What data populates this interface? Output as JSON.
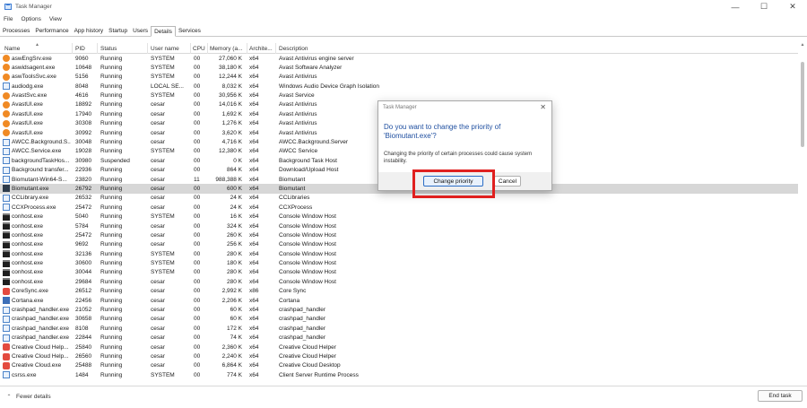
{
  "window": {
    "title": "Task Manager",
    "controls": [
      "—",
      "☐",
      "✕"
    ]
  },
  "menu": [
    "File",
    "Options",
    "View"
  ],
  "tabs": [
    {
      "label": "Processes",
      "active": false
    },
    {
      "label": "Performance",
      "active": false
    },
    {
      "label": "App history",
      "active": false
    },
    {
      "label": "Startup",
      "active": false
    },
    {
      "label": "Users",
      "active": false
    },
    {
      "label": "Details",
      "active": true
    },
    {
      "label": "Services",
      "active": false
    }
  ],
  "columns": {
    "name": "Name",
    "pid": "PID",
    "status": "Status",
    "user": "User name",
    "cpu": "CPU",
    "memory": "Memory (a...",
    "arch": "Archite...",
    "desc": "Description"
  },
  "rows": [
    {
      "icon": "avast",
      "name": "aswEngSrv.exe",
      "pid": "9060",
      "status": "Running",
      "user": "SYSTEM",
      "cpu": "00",
      "mem": "27,060 K",
      "arch": "x64",
      "desc": "Avast Antivirus engine server"
    },
    {
      "icon": "avast",
      "name": "aswidsagent.exe",
      "pid": "10648",
      "status": "Running",
      "user": "SYSTEM",
      "cpu": "00",
      "mem": "38,180 K",
      "arch": "x64",
      "desc": "Avast Software Analyzer"
    },
    {
      "icon": "avast",
      "name": "aswToolsSvc.exe",
      "pid": "5156",
      "status": "Running",
      "user": "SYSTEM",
      "cpu": "00",
      "mem": "12,244 K",
      "arch": "x64",
      "desc": "Avast Antivirus"
    },
    {
      "icon": "app",
      "name": "audiodg.exe",
      "pid": "8048",
      "status": "Running",
      "user": "LOCAL SE...",
      "cpu": "00",
      "mem": "8,032 K",
      "arch": "x64",
      "desc": "Windows Audio Device Graph Isolation"
    },
    {
      "icon": "avast",
      "name": "AvastSvc.exe",
      "pid": "4616",
      "status": "Running",
      "user": "SYSTEM",
      "cpu": "00",
      "mem": "30,956 K",
      "arch": "x64",
      "desc": "Avast Service"
    },
    {
      "icon": "avast",
      "name": "AvastUI.exe",
      "pid": "18892",
      "status": "Running",
      "user": "cesar",
      "cpu": "00",
      "mem": "14,016 K",
      "arch": "x64",
      "desc": "Avast Antivirus"
    },
    {
      "icon": "avast",
      "name": "AvastUI.exe",
      "pid": "17940",
      "status": "Running",
      "user": "cesar",
      "cpu": "00",
      "mem": "1,692 K",
      "arch": "x64",
      "desc": "Avast Antivirus"
    },
    {
      "icon": "avast",
      "name": "AvastUI.exe",
      "pid": "30308",
      "status": "Running",
      "user": "cesar",
      "cpu": "00",
      "mem": "1,276 K",
      "arch": "x64",
      "desc": "Avast Antivirus"
    },
    {
      "icon": "avast",
      "name": "AvastUI.exe",
      "pid": "30992",
      "status": "Running",
      "user": "cesar",
      "cpu": "00",
      "mem": "3,620 K",
      "arch": "x64",
      "desc": "Avast Antivirus"
    },
    {
      "icon": "app",
      "name": "AWCC.Background.S...",
      "pid": "30048",
      "status": "Running",
      "user": "cesar",
      "cpu": "00",
      "mem": "4,716 K",
      "arch": "x64",
      "desc": "AWCC.Background.Server"
    },
    {
      "icon": "app",
      "name": "AWCC.Service.exe",
      "pid": "19028",
      "status": "Running",
      "user": "SYSTEM",
      "cpu": "00",
      "mem": "12,380 K",
      "arch": "x64",
      "desc": "AWCC Service"
    },
    {
      "icon": "app",
      "name": "backgroundTaskHos...",
      "pid": "30980",
      "status": "Suspended",
      "user": "cesar",
      "cpu": "00",
      "mem": "0 K",
      "arch": "x64",
      "desc": "Background Task Host"
    },
    {
      "icon": "app",
      "name": "Background transfer...",
      "pid": "22936",
      "status": "Running",
      "user": "cesar",
      "cpu": "00",
      "mem": "864 K",
      "arch": "x64",
      "desc": "Download/Upload Host"
    },
    {
      "icon": "app",
      "name": "Biomutant-Win64-S...",
      "pid": "23820",
      "status": "Running",
      "user": "cesar",
      "cpu": "11",
      "mem": "988,388 K",
      "arch": "x64",
      "desc": "Biomutant"
    },
    {
      "icon": "game",
      "name": "Biomutant.exe",
      "pid": "26792",
      "status": "Running",
      "user": "cesar",
      "cpu": "00",
      "mem": "600 K",
      "arch": "x64",
      "desc": "Biomutant",
      "selected": true
    },
    {
      "icon": "app",
      "name": "CCLibrary.exe",
      "pid": "26532",
      "status": "Running",
      "user": "cesar",
      "cpu": "00",
      "mem": "24 K",
      "arch": "x64",
      "desc": "CCLibraries"
    },
    {
      "icon": "app",
      "name": "CCXProcess.exe",
      "pid": "25472",
      "status": "Running",
      "user": "cesar",
      "cpu": "00",
      "mem": "24 K",
      "arch": "x64",
      "desc": "CCXProcess"
    },
    {
      "icon": "con",
      "name": "conhost.exe",
      "pid": "5040",
      "status": "Running",
      "user": "SYSTEM",
      "cpu": "00",
      "mem": "16 K",
      "arch": "x64",
      "desc": "Console Window Host"
    },
    {
      "icon": "con",
      "name": "conhost.exe",
      "pid": "5784",
      "status": "Running",
      "user": "cesar",
      "cpu": "00",
      "mem": "324 K",
      "arch": "x64",
      "desc": "Console Window Host"
    },
    {
      "icon": "con",
      "name": "conhost.exe",
      "pid": "25472",
      "status": "Running",
      "user": "cesar",
      "cpu": "00",
      "mem": "260 K",
      "arch": "x64",
      "desc": "Console Window Host"
    },
    {
      "icon": "con",
      "name": "conhost.exe",
      "pid": "9692",
      "status": "Running",
      "user": "cesar",
      "cpu": "00",
      "mem": "256 K",
      "arch": "x64",
      "desc": "Console Window Host"
    },
    {
      "icon": "con",
      "name": "conhost.exe",
      "pid": "32136",
      "status": "Running",
      "user": "SYSTEM",
      "cpu": "00",
      "mem": "280 K",
      "arch": "x64",
      "desc": "Console Window Host"
    },
    {
      "icon": "con",
      "name": "conhost.exe",
      "pid": "30600",
      "status": "Running",
      "user": "SYSTEM",
      "cpu": "00",
      "mem": "180 K",
      "arch": "x64",
      "desc": "Console Window Host"
    },
    {
      "icon": "con",
      "name": "conhost.exe",
      "pid": "30044",
      "status": "Running",
      "user": "SYSTEM",
      "cpu": "00",
      "mem": "280 K",
      "arch": "x64",
      "desc": "Console Window Host"
    },
    {
      "icon": "con",
      "name": "conhost.exe",
      "pid": "29684",
      "status": "Running",
      "user": "cesar",
      "cpu": "00",
      "mem": "280 K",
      "arch": "x64",
      "desc": "Console Window Host"
    },
    {
      "icon": "cc",
      "name": "CoreSync.exe",
      "pid": "26512",
      "status": "Running",
      "user": "cesar",
      "cpu": "00",
      "mem": "2,992 K",
      "arch": "x86",
      "desc": "Core Sync"
    },
    {
      "icon": "blue",
      "name": "Cortana.exe",
      "pid": "22456",
      "status": "Running",
      "user": "cesar",
      "cpu": "00",
      "mem": "2,206 K",
      "arch": "x64",
      "desc": "Cortana"
    },
    {
      "icon": "app",
      "name": "crashpad_handler.exe",
      "pid": "21052",
      "status": "Running",
      "user": "cesar",
      "cpu": "00",
      "mem": "60 K",
      "arch": "x64",
      "desc": "crashpad_handler"
    },
    {
      "icon": "app",
      "name": "crashpad_handler.exe",
      "pid": "30658",
      "status": "Running",
      "user": "cesar",
      "cpu": "00",
      "mem": "60 K",
      "arch": "x64",
      "desc": "crashpad_handler"
    },
    {
      "icon": "app",
      "name": "crashpad_handler.exe",
      "pid": "8108",
      "status": "Running",
      "user": "cesar",
      "cpu": "00",
      "mem": "172 K",
      "arch": "x64",
      "desc": "crashpad_handler"
    },
    {
      "icon": "app",
      "name": "crashpad_handler.exe",
      "pid": "22844",
      "status": "Running",
      "user": "cesar",
      "cpu": "00",
      "mem": "74 K",
      "arch": "x64",
      "desc": "crashpad_handler"
    },
    {
      "icon": "cc",
      "name": "Creative Cloud Help...",
      "pid": "25840",
      "status": "Running",
      "user": "cesar",
      "cpu": "00",
      "mem": "2,360 K",
      "arch": "x64",
      "desc": "Creative Cloud Helper"
    },
    {
      "icon": "cc",
      "name": "Creative Cloud Help...",
      "pid": "26560",
      "status": "Running",
      "user": "cesar",
      "cpu": "00",
      "mem": "2,240 K",
      "arch": "x64",
      "desc": "Creative Cloud Helper"
    },
    {
      "icon": "cc",
      "name": "Creative Cloud.exe",
      "pid": "25488",
      "status": "Running",
      "user": "cesar",
      "cpu": "00",
      "mem": "6,864 K",
      "arch": "x64",
      "desc": "Creative Cloud Desktop"
    },
    {
      "icon": "app",
      "name": "csrss.exe",
      "pid": "1484",
      "status": "Running",
      "user": "SYSTEM",
      "cpu": "00",
      "mem": "774 K",
      "arch": "x64",
      "desc": "Client Server Runtime Process"
    }
  ],
  "footer": {
    "fewer_details": "Fewer details",
    "end_task": "End task"
  },
  "dialog": {
    "title": "Task Manager",
    "heading": "Do you want to change the priority of 'Biomutant.exe'?",
    "body": "Changing the priority of certain processes could cause system instability.",
    "change_button": "Change priority",
    "cancel_button": "Cancel"
  },
  "colors": {
    "accent": "#2b6dc5",
    "highlight": "#e0201f",
    "selected_row": "#d7d7d7",
    "dialog_heading": "#1f4fa0"
  }
}
